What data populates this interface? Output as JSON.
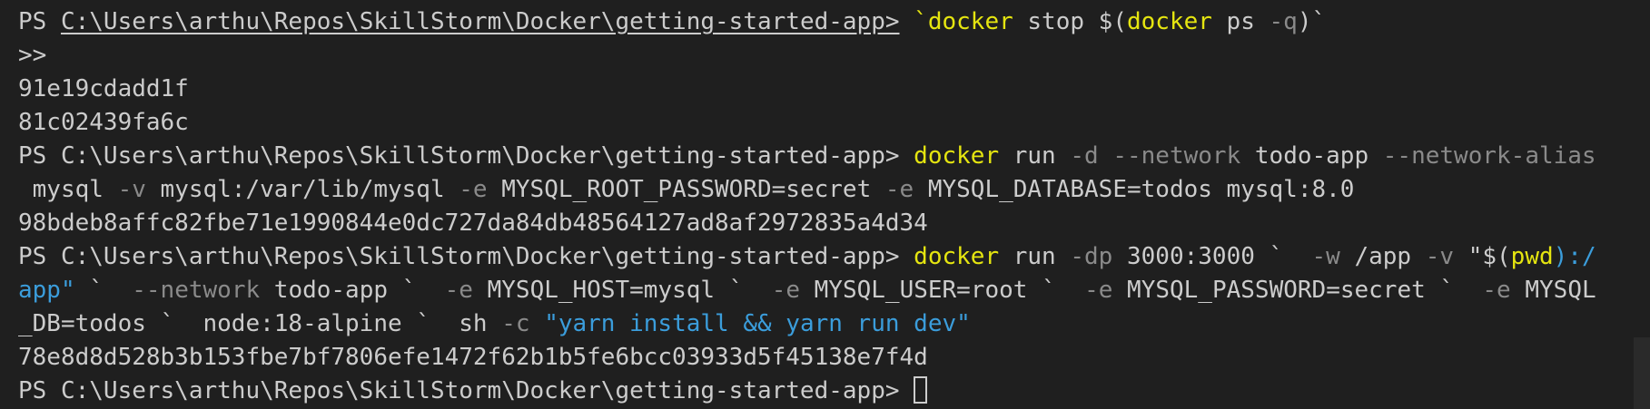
{
  "colors": {
    "background": "#1f1f1f",
    "default_text": "#cccccc",
    "command": "#e5e510",
    "parameter": "#8a8a8a",
    "string": "#3b9ddb"
  },
  "terminal": {
    "lines": [
      [
        {
          "t": "PS ",
          "c": "w"
        },
        {
          "t": "C:\\Users\\arthu\\Repos\\SkillStorm\\Docker\\getting-started-app>",
          "c": "w u"
        },
        {
          "t": " `",
          "c": "y"
        },
        {
          "t": "docker",
          "c": "y"
        },
        {
          "t": " stop $(",
          "c": "w"
        },
        {
          "t": "docker",
          "c": "y"
        },
        {
          "t": " ps ",
          "c": "w"
        },
        {
          "t": "-q",
          "c": "g"
        },
        {
          "t": ")`",
          "c": "w"
        }
      ],
      [
        {
          "t": ">>",
          "c": "w"
        }
      ],
      [
        {
          "t": "91e19cdadd1f",
          "c": "w"
        }
      ],
      [
        {
          "t": "81c02439fa6c",
          "c": "w"
        }
      ],
      [
        {
          "t": "PS C:\\Users\\arthu\\Repos\\SkillStorm\\Docker\\getting-started-app> ",
          "c": "w"
        },
        {
          "t": "docker",
          "c": "y"
        },
        {
          "t": " run ",
          "c": "w"
        },
        {
          "t": "-d",
          "c": "g"
        },
        {
          "t": " ",
          "c": "w"
        },
        {
          "t": "--network",
          "c": "g"
        },
        {
          "t": " todo-app ",
          "c": "w"
        },
        {
          "t": "--network-alias",
          "c": "g"
        }
      ],
      [
        {
          "t": " mysql ",
          "c": "w"
        },
        {
          "t": "-v",
          "c": "g"
        },
        {
          "t": " mysql:/var/lib/mysql ",
          "c": "w"
        },
        {
          "t": "-e",
          "c": "g"
        },
        {
          "t": " MYSQL_ROOT_PASSWORD=secret ",
          "c": "w"
        },
        {
          "t": "-e",
          "c": "g"
        },
        {
          "t": " MYSQL_DATABASE=todos mysql:8.0",
          "c": "w"
        }
      ],
      [
        {
          "t": "98bdeb8affc82fbe71e1990844e0dc727da84db48564127ad8af2972835a4d34",
          "c": "w"
        }
      ],
      [
        {
          "t": "PS C:\\Users\\arthu\\Repos\\SkillStorm\\Docker\\getting-started-app> ",
          "c": "w"
        },
        {
          "t": "docker",
          "c": "y"
        },
        {
          "t": " run ",
          "c": "w"
        },
        {
          "t": "-dp",
          "c": "g"
        },
        {
          "t": " 3000:3000 `  ",
          "c": "w"
        },
        {
          "t": "-w",
          "c": "g"
        },
        {
          "t": " /app ",
          "c": "w"
        },
        {
          "t": "-v",
          "c": "g"
        },
        {
          "t": " \"$(",
          "c": "w"
        },
        {
          "t": "pwd",
          "c": "y"
        },
        {
          "t": "):/",
          "c": "b"
        }
      ],
      [
        {
          "t": "app\"",
          "c": "b"
        },
        {
          "t": " `  ",
          "c": "w"
        },
        {
          "t": "--network",
          "c": "g"
        },
        {
          "t": " todo-app `  ",
          "c": "w"
        },
        {
          "t": "-e",
          "c": "g"
        },
        {
          "t": " MYSQL_HOST=mysql `  ",
          "c": "w"
        },
        {
          "t": "-e",
          "c": "g"
        },
        {
          "t": " MYSQL_USER=root `  ",
          "c": "w"
        },
        {
          "t": "-e",
          "c": "g"
        },
        {
          "t": " MYSQL_PASSWORD=secret `  ",
          "c": "w"
        },
        {
          "t": "-e",
          "c": "g"
        },
        {
          "t": " MYSQL",
          "c": "w"
        }
      ],
      [
        {
          "t": "_DB=todos `  node:18-alpine `  sh ",
          "c": "w"
        },
        {
          "t": "-c",
          "c": "g"
        },
        {
          "t": " ",
          "c": "w"
        },
        {
          "t": "\"yarn install && yarn run dev\"",
          "c": "b"
        }
      ],
      [
        {
          "t": "78e8d8d528b3b153fbe7bf7806efe1472f62b1b5fe6bcc03933d5f45138e7f4d",
          "c": "w"
        }
      ],
      [
        {
          "t": "PS C:\\Users\\arthu\\Repos\\SkillStorm\\Docker\\getting-started-app> ",
          "c": "w"
        }
      ]
    ]
  }
}
